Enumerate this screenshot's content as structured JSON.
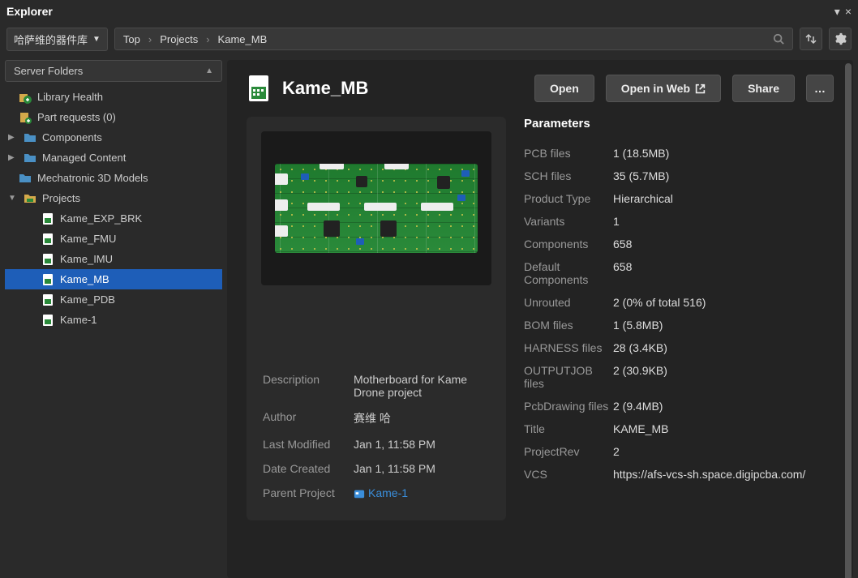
{
  "window": {
    "title": "Explorer"
  },
  "toolbar": {
    "library_dropdown": "哈萨维的器件库",
    "breadcrumbs": [
      "Top",
      "Projects",
      "Kame_MB"
    ]
  },
  "sidebar": {
    "header": "Server Folders",
    "items": [
      {
        "label": "Library Health",
        "icon": "health",
        "indent": 1,
        "expandable": false
      },
      {
        "label": "Part requests (0)",
        "icon": "requests",
        "indent": 1,
        "expandable": false
      },
      {
        "label": "Components",
        "icon": "folder",
        "indent": 0,
        "expandable": true
      },
      {
        "label": "Managed Content",
        "icon": "folder",
        "indent": 0,
        "expandable": true
      },
      {
        "label": "Mechatronic 3D Models",
        "icon": "folder",
        "indent": 1,
        "expandable": false
      },
      {
        "label": "Projects",
        "icon": "projects",
        "indent": 0,
        "expandable": true,
        "expanded": true
      },
      {
        "label": "Kame_EXP_BRK",
        "icon": "proj",
        "indent": 2
      },
      {
        "label": "Kame_FMU",
        "icon": "proj",
        "indent": 2
      },
      {
        "label": "Kame_IMU",
        "icon": "proj",
        "indent": 2
      },
      {
        "label": "Kame_MB",
        "icon": "proj",
        "indent": 2,
        "selected": true
      },
      {
        "label": "Kame_PDB",
        "icon": "proj",
        "indent": 2
      },
      {
        "label": "Kame-1",
        "icon": "proj",
        "indent": 2
      }
    ]
  },
  "detail": {
    "title": "Kame_MB",
    "buttons": {
      "open": "Open",
      "open_web": "Open in Web",
      "share": "Share",
      "more": "…"
    },
    "meta": {
      "description_label": "Description",
      "description": "Motherboard for Kame Drone project",
      "author_label": "Author",
      "author": "赛维 哈",
      "last_modified_label": "Last Modified",
      "last_modified": "Jan 1, 11:58 PM",
      "date_created_label": "Date Created",
      "date_created": "Jan 1, 11:58 PM",
      "parent_label": "Parent Project",
      "parent": "Kame-1"
    },
    "params_title": "Parameters",
    "params": [
      {
        "k": "PCB files",
        "v": "1 (18.5MB)"
      },
      {
        "k": "SCH files",
        "v": "35 (5.7MB)"
      },
      {
        "k": "Product Type",
        "v": "Hierarchical"
      },
      {
        "k": "Variants",
        "v": "1"
      },
      {
        "k": "Components",
        "v": "658"
      },
      {
        "k": "Default Components",
        "v": "658"
      },
      {
        "k": "Unrouted",
        "v": "2 (0% of total 516)"
      },
      {
        "k": "BOM files",
        "v": "1 (5.8MB)"
      },
      {
        "k": "HARNESS files",
        "v": "28 (3.4KB)"
      },
      {
        "k": "OUTPUTJOB files",
        "v": "2 (30.9KB)"
      },
      {
        "k": "PcbDrawing files",
        "v": "2 (9.4MB)"
      },
      {
        "k": "Title",
        "v": "KAME_MB"
      },
      {
        "k": "ProjectRev",
        "v": "2"
      },
      {
        "k": "VCS",
        "v": "https://afs-vcs-sh.space.digipcba.com/"
      }
    ]
  }
}
